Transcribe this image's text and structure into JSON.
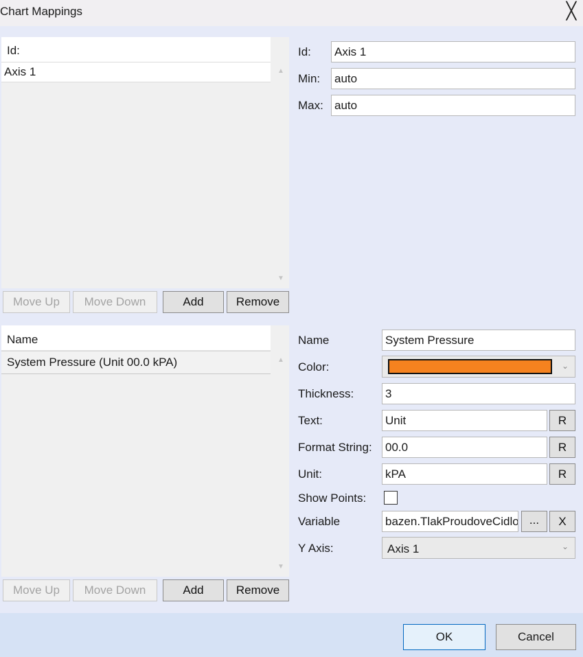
{
  "window": {
    "title": "Chart Mappings",
    "close_glyph": "╳"
  },
  "axes": {
    "list_header": "Id:",
    "items": [
      {
        "label": "Axis 1"
      }
    ],
    "buttons": {
      "move_up": "Move Up",
      "move_down": "Move Down",
      "add": "Add",
      "remove": "Remove"
    },
    "form": {
      "id_label": "Id:",
      "id_value": "Axis 1",
      "min_label": "Min:",
      "min_value": "auto",
      "max_label": "Max:",
      "max_value": "auto"
    }
  },
  "series": {
    "list_header": "Name",
    "items": [
      {
        "label": "System Pressure (Unit 00.0 kPA)"
      }
    ],
    "buttons": {
      "move_up": "Move Up",
      "move_down": "Move Down",
      "add": "Add",
      "remove": "Remove"
    },
    "form": {
      "name_label": "Name",
      "name_value": "System Pressure",
      "color_label": "Color:",
      "color_value": "#f5821f",
      "thickness_label": "Thickness:",
      "thickness_value": "3",
      "text_label": "Text:",
      "text_value": "Unit",
      "format_label": "Format String:",
      "format_value": "00.0",
      "unit_label": "Unit:",
      "unit_value": "kPA",
      "reset_label": "R",
      "show_points_label": "Show Points:",
      "show_points_checked": false,
      "variable_label": "Variable",
      "variable_value": "bazen.TlakProudoveCidlo",
      "browse_label": "...",
      "clear_label": "X",
      "yaxis_label": "Y Axis:",
      "yaxis_value": "Axis 1"
    }
  },
  "footer": {
    "ok": "OK",
    "cancel": "Cancel"
  }
}
